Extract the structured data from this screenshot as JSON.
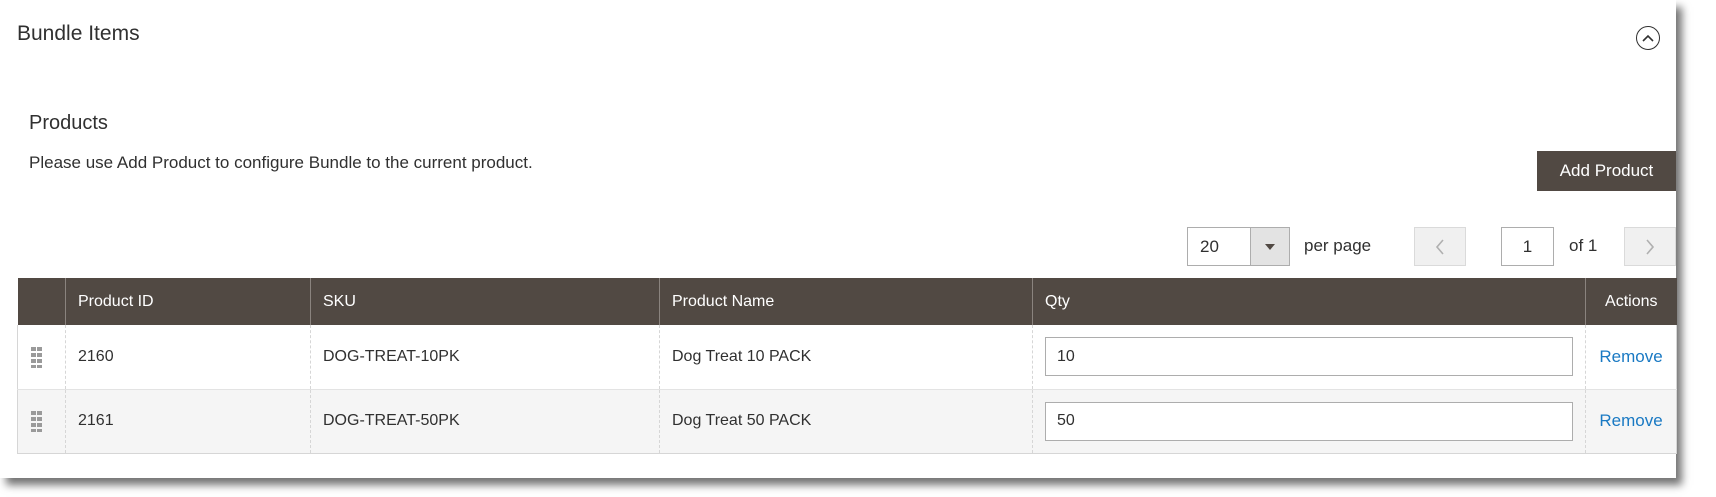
{
  "section": {
    "title": "Bundle Items"
  },
  "products": {
    "title": "Products",
    "note": "Please use Add Product to configure Bundle to the current product.",
    "add_button": "Add Product"
  },
  "pager": {
    "per_page_value": "20",
    "per_page_label": "per page",
    "current_page": "1",
    "of_label": "of 1"
  },
  "table": {
    "columns": [
      "",
      "Product ID",
      "SKU",
      "Product Name",
      "Qty",
      "Actions"
    ],
    "rows": [
      {
        "product_id": "2160",
        "sku": "DOG-TREAT-10PK",
        "name": "Dog Treat 10 PACK",
        "qty": "10",
        "action": "Remove"
      },
      {
        "product_id": "2161",
        "sku": "DOG-TREAT-50PK",
        "name": "Dog Treat 50 PACK",
        "qty": "50",
        "action": "Remove"
      }
    ]
  },
  "icons": {
    "collapse": "chevron-up-circle-icon",
    "select_arrow": "caret-down-icon",
    "prev": "chevron-left-icon",
    "next": "chevron-right-icon",
    "drag": "drag-handle-icon"
  },
  "colors": {
    "header_bg": "#514943",
    "button_bg": "#514943",
    "link": "#1979c3",
    "row_alt": "#f5f5f5"
  }
}
